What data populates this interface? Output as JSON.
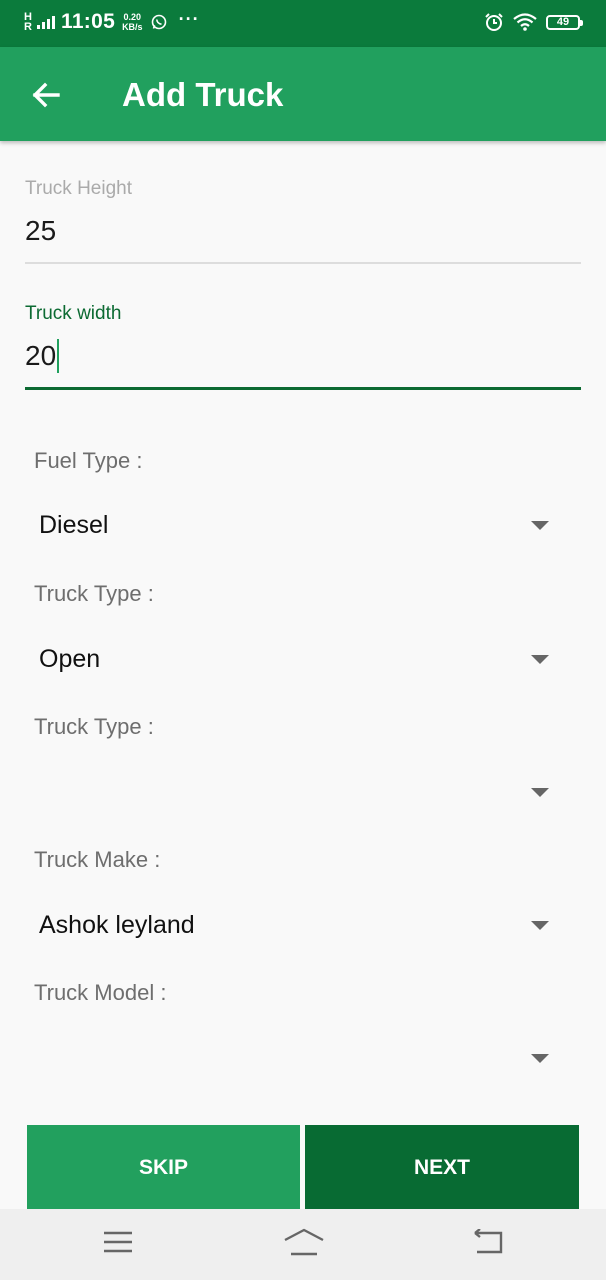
{
  "status_bar": {
    "network": "H",
    "network_sub": "R",
    "time": "11:05",
    "speed_value": "0.20",
    "speed_unit": "KB/s",
    "more": "···",
    "battery": "49"
  },
  "app_bar": {
    "title": "Add Truck",
    "back_icon": "arrow-left-icon"
  },
  "fields": {
    "height": {
      "label": "Truck Height",
      "value": "25"
    },
    "width": {
      "label": "Truck width",
      "value": "20"
    }
  },
  "spinners": [
    {
      "label": "Fuel Type :",
      "value": "Diesel"
    },
    {
      "label": "Truck Type :",
      "value": "Open"
    },
    {
      "label": "Truck Type :",
      "value": ""
    },
    {
      "label": "Truck Make :",
      "value": "Ashok leyland"
    },
    {
      "label": "Truck Model :",
      "value": ""
    }
  ],
  "buttons": {
    "skip": "SKIP",
    "next": "NEXT"
  },
  "colors": {
    "status_bar": "#0b7b3c",
    "app_bar": "#21a05e",
    "accent": "#0c6a32",
    "skip_button": "#22a05e",
    "next_button": "#086b33"
  },
  "nav_bar": {
    "icons": [
      "menu-icon",
      "home-icon",
      "back-icon"
    ]
  }
}
